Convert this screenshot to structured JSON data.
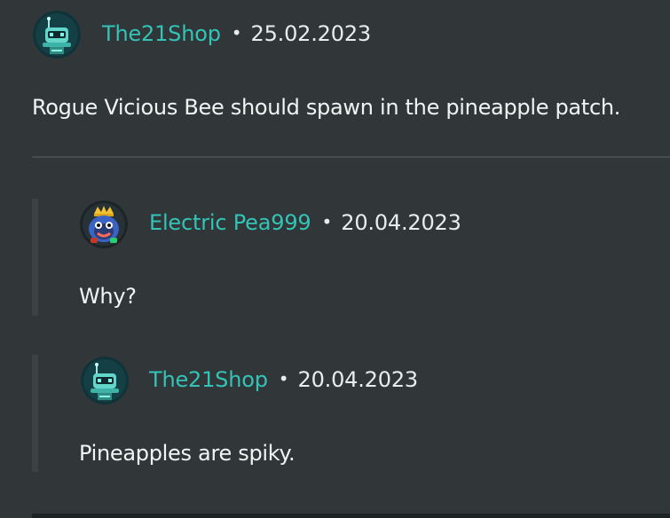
{
  "comments": [
    {
      "username": "The21Shop",
      "separator": "•",
      "date": "25.02.2023",
      "text": "Rogue Vicious Bee should spawn in the pineapple patch.",
      "avatar": "robot-avatar-icon"
    }
  ],
  "replies": [
    {
      "username": "Electric Pea999",
      "separator": "•",
      "date": "20.04.2023",
      "text": "Why?",
      "avatar": "crowned-character-avatar-icon"
    },
    {
      "username": "The21Shop",
      "separator": "•",
      "date": "20.04.2023",
      "text": "Pineapples are spiky.",
      "avatar": "robot-avatar-icon"
    }
  ],
  "colors": {
    "background": "#313738",
    "username": "#33c3b7",
    "text": "#e8ecec"
  }
}
